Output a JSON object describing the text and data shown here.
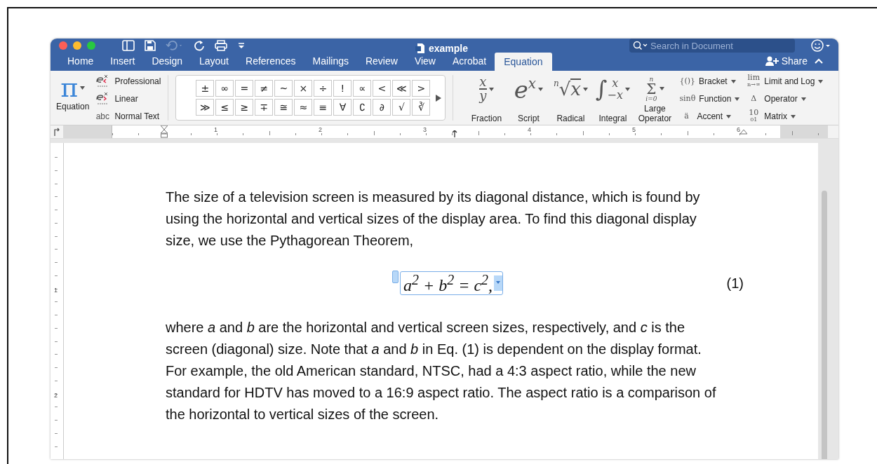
{
  "title_bar": {
    "title": "example",
    "search": {
      "placeholder": "Search in Document"
    }
  },
  "tabs": [
    {
      "label": "Home",
      "selected": false
    },
    {
      "label": "Insert",
      "selected": false
    },
    {
      "label": "Design",
      "selected": false
    },
    {
      "label": "Layout",
      "selected": false
    },
    {
      "label": "References",
      "selected": false
    },
    {
      "label": "Mailings",
      "selected": false
    },
    {
      "label": "Review",
      "selected": false
    },
    {
      "label": "View",
      "selected": false
    },
    {
      "label": "Acrobat",
      "selected": false
    },
    {
      "label": "Equation",
      "selected": true
    }
  ],
  "share": {
    "label": "Share"
  },
  "ribbon": {
    "equation": {
      "symbol": "π",
      "label": "Equation"
    },
    "conversions": [
      {
        "kind": "professional",
        "label": "Professional"
      },
      {
        "kind": "linear",
        "label": "Linear"
      },
      {
        "kind": "normal",
        "prefix": "abc",
        "label": "Normal Text"
      }
    ],
    "symbols": [
      [
        "±",
        "∞",
        "=",
        "≠",
        "~",
        "×",
        "÷",
        "!",
        "∝",
        "<",
        "≪",
        ">"
      ],
      [
        "≫",
        "≤",
        "≥",
        "∓",
        "≅",
        "≈",
        "≡",
        "∀",
        "∁",
        "∂",
        "√",
        "∛"
      ]
    ],
    "structures": [
      {
        "kind": "fraction",
        "top": "x",
        "bottom": "y",
        "label": "Fraction"
      },
      {
        "kind": "script",
        "base": "e",
        "sup": "x",
        "label": "Script"
      },
      {
        "kind": "radical",
        "index": "n",
        "sign": "√",
        "base": "x",
        "label": "Radical"
      },
      {
        "kind": "integral",
        "sign": "∫",
        "sup": "x",
        "sub": "−x",
        "label": "Integral"
      },
      {
        "kind": "operator",
        "top": "n",
        "sign": "Σ",
        "bottom": "i=0",
        "label": "Large Operator"
      }
    ],
    "small_structures": [
      [
        {
          "symbol": "{()}",
          "label": "Bracket"
        },
        {
          "symbol": "sinθ",
          "label": "Function"
        },
        {
          "symbol": "ä",
          "label": "Accent"
        }
      ],
      [
        {
          "symbol": "lim",
          "symbol_sub": "n→∞",
          "label": "Limit and Log"
        },
        {
          "symbol": "Δ",
          "label": "Operator"
        },
        {
          "symbol": "10",
          "symbol_sub": "01",
          "label": "Matrix"
        }
      ]
    ]
  },
  "ruler": {
    "numbers": [
      "1",
      "2",
      "3",
      "4",
      "5",
      "6"
    ]
  },
  "vertical_ruler": {
    "numbers": [
      "1",
      "2"
    ]
  },
  "document": {
    "paragraphs": [
      "The size of a television screen is measured by its diagonal distance, which is found by using the horizontal and vertical sizes of the display area.  To find this diagonal display size, we use the Pythagorean Theorem,"
    ],
    "equation": {
      "text": "a$^{2}$ + b$^{2}$ = c$^{2}$,",
      "number": "(1)"
    },
    "paragraphs_after": [
      "where *a* and *b* are the horizontal and vertical screen sizes, respectively, and *c* is the screen (diagonal) size.  Note that *a* and *b* in Eq. (1) is dependent on the display format.  For example, the old American standard, NTSC, had a 4:3 aspect ratio, while the new standard for HDTV has moved to a 16:9 aspect ratio. The aspect ratio is a comparison of the horizontal to vertical sizes of the screen."
    ]
  }
}
